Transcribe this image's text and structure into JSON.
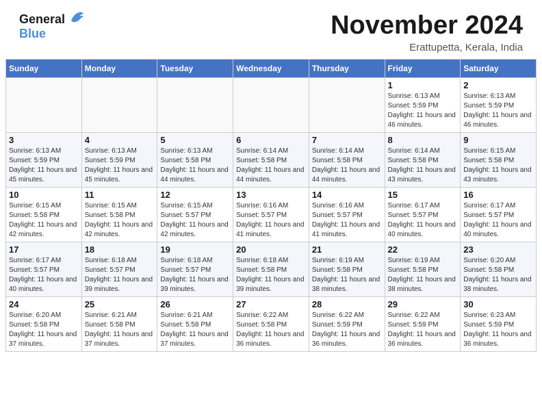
{
  "header": {
    "logo_line1": "General",
    "logo_line2": "Blue",
    "month_title": "November 2024",
    "location": "Erattupetta, Kerala, India"
  },
  "days_of_week": [
    "Sunday",
    "Monday",
    "Tuesday",
    "Wednesday",
    "Thursday",
    "Friday",
    "Saturday"
  ],
  "weeks": [
    [
      {
        "day": "",
        "text": "",
        "empty": true
      },
      {
        "day": "",
        "text": "",
        "empty": true
      },
      {
        "day": "",
        "text": "",
        "empty": true
      },
      {
        "day": "",
        "text": "",
        "empty": true
      },
      {
        "day": "",
        "text": "",
        "empty": true
      },
      {
        "day": "1",
        "text": "Sunrise: 6:13 AM\nSunset: 5:59 PM\nDaylight: 11 hours and 46 minutes.",
        "empty": false
      },
      {
        "day": "2",
        "text": "Sunrise: 6:13 AM\nSunset: 5:59 PM\nDaylight: 11 hours and 46 minutes.",
        "empty": false
      }
    ],
    [
      {
        "day": "3",
        "text": "Sunrise: 6:13 AM\nSunset: 5:59 PM\nDaylight: 11 hours and 45 minutes.",
        "empty": false
      },
      {
        "day": "4",
        "text": "Sunrise: 6:13 AM\nSunset: 5:59 PM\nDaylight: 11 hours and 45 minutes.",
        "empty": false
      },
      {
        "day": "5",
        "text": "Sunrise: 6:13 AM\nSunset: 5:58 PM\nDaylight: 11 hours and 44 minutes.",
        "empty": false
      },
      {
        "day": "6",
        "text": "Sunrise: 6:14 AM\nSunset: 5:58 PM\nDaylight: 11 hours and 44 minutes.",
        "empty": false
      },
      {
        "day": "7",
        "text": "Sunrise: 6:14 AM\nSunset: 5:58 PM\nDaylight: 11 hours and 44 minutes.",
        "empty": false
      },
      {
        "day": "8",
        "text": "Sunrise: 6:14 AM\nSunset: 5:58 PM\nDaylight: 11 hours and 43 minutes.",
        "empty": false
      },
      {
        "day": "9",
        "text": "Sunrise: 6:15 AM\nSunset: 5:58 PM\nDaylight: 11 hours and 43 minutes.",
        "empty": false
      }
    ],
    [
      {
        "day": "10",
        "text": "Sunrise: 6:15 AM\nSunset: 5:58 PM\nDaylight: 11 hours and 42 minutes.",
        "empty": false
      },
      {
        "day": "11",
        "text": "Sunrise: 6:15 AM\nSunset: 5:58 PM\nDaylight: 11 hours and 42 minutes.",
        "empty": false
      },
      {
        "day": "12",
        "text": "Sunrise: 6:15 AM\nSunset: 5:57 PM\nDaylight: 11 hours and 42 minutes.",
        "empty": false
      },
      {
        "day": "13",
        "text": "Sunrise: 6:16 AM\nSunset: 5:57 PM\nDaylight: 11 hours and 41 minutes.",
        "empty": false
      },
      {
        "day": "14",
        "text": "Sunrise: 6:16 AM\nSunset: 5:57 PM\nDaylight: 11 hours and 41 minutes.",
        "empty": false
      },
      {
        "day": "15",
        "text": "Sunrise: 6:17 AM\nSunset: 5:57 PM\nDaylight: 11 hours and 40 minutes.",
        "empty": false
      },
      {
        "day": "16",
        "text": "Sunrise: 6:17 AM\nSunset: 5:57 PM\nDaylight: 11 hours and 40 minutes.",
        "empty": false
      }
    ],
    [
      {
        "day": "17",
        "text": "Sunrise: 6:17 AM\nSunset: 5:57 PM\nDaylight: 11 hours and 40 minutes.",
        "empty": false
      },
      {
        "day": "18",
        "text": "Sunrise: 6:18 AM\nSunset: 5:57 PM\nDaylight: 11 hours and 39 minutes.",
        "empty": false
      },
      {
        "day": "19",
        "text": "Sunrise: 6:18 AM\nSunset: 5:57 PM\nDaylight: 11 hours and 39 minutes.",
        "empty": false
      },
      {
        "day": "20",
        "text": "Sunrise: 6:18 AM\nSunset: 5:58 PM\nDaylight: 11 hours and 39 minutes.",
        "empty": false
      },
      {
        "day": "21",
        "text": "Sunrise: 6:19 AM\nSunset: 5:58 PM\nDaylight: 11 hours and 38 minutes.",
        "empty": false
      },
      {
        "day": "22",
        "text": "Sunrise: 6:19 AM\nSunset: 5:58 PM\nDaylight: 11 hours and 38 minutes.",
        "empty": false
      },
      {
        "day": "23",
        "text": "Sunrise: 6:20 AM\nSunset: 5:58 PM\nDaylight: 11 hours and 38 minutes.",
        "empty": false
      }
    ],
    [
      {
        "day": "24",
        "text": "Sunrise: 6:20 AM\nSunset: 5:58 PM\nDaylight: 11 hours and 37 minutes.",
        "empty": false
      },
      {
        "day": "25",
        "text": "Sunrise: 6:21 AM\nSunset: 5:58 PM\nDaylight: 11 hours and 37 minutes.",
        "empty": false
      },
      {
        "day": "26",
        "text": "Sunrise: 6:21 AM\nSunset: 5:58 PM\nDaylight: 11 hours and 37 minutes.",
        "empty": false
      },
      {
        "day": "27",
        "text": "Sunrise: 6:22 AM\nSunset: 5:58 PM\nDaylight: 11 hours and 36 minutes.",
        "empty": false
      },
      {
        "day": "28",
        "text": "Sunrise: 6:22 AM\nSunset: 5:59 PM\nDaylight: 11 hours and 36 minutes.",
        "empty": false
      },
      {
        "day": "29",
        "text": "Sunrise: 6:22 AM\nSunset: 5:59 PM\nDaylight: 11 hours and 36 minutes.",
        "empty": false
      },
      {
        "day": "30",
        "text": "Sunrise: 6:23 AM\nSunset: 5:59 PM\nDaylight: 11 hours and 36 minutes.",
        "empty": false
      }
    ]
  ]
}
